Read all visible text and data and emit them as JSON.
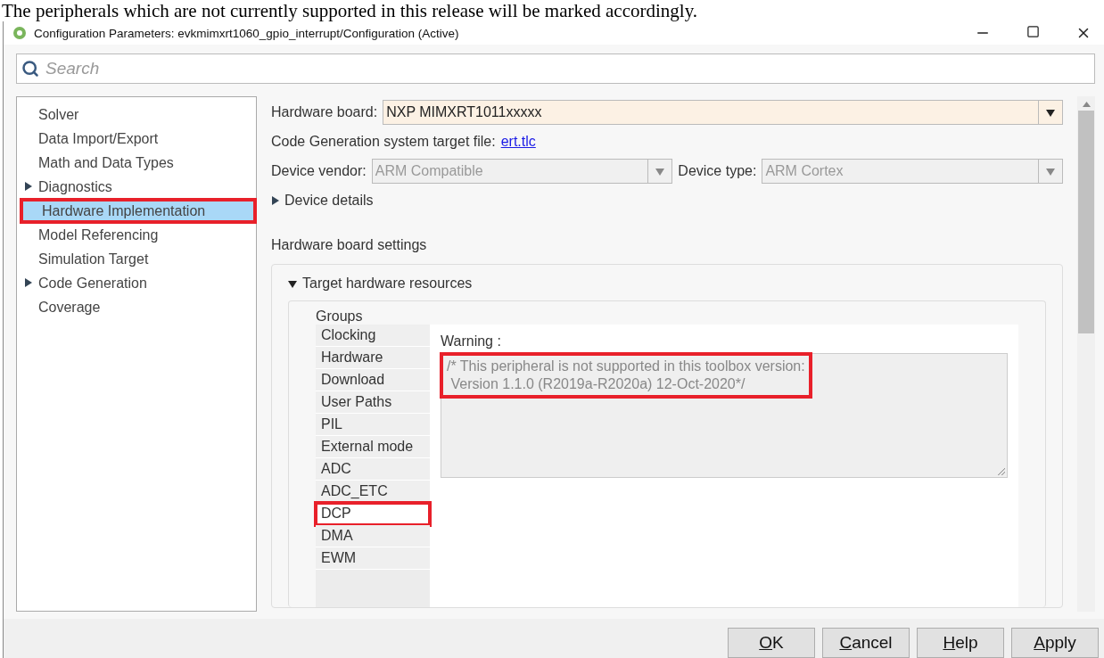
{
  "caption": "The peripherals which are not currently supported in this release will be marked accordingly.",
  "window": {
    "title": "Configuration Parameters: evkmimxrt1060_gpio_interrupt/Configuration (Active)"
  },
  "search": {
    "placeholder": "Search"
  },
  "sidebar": {
    "items": [
      {
        "label": "Solver",
        "expandable": false,
        "selected": false,
        "highlighted": false
      },
      {
        "label": "Data Import/Export",
        "expandable": false,
        "selected": false,
        "highlighted": false
      },
      {
        "label": "Math and Data Types",
        "expandable": false,
        "selected": false,
        "highlighted": false
      },
      {
        "label": "Diagnostics",
        "expandable": true,
        "selected": false,
        "highlighted": false
      },
      {
        "label": "Hardware Implementation",
        "expandable": false,
        "selected": true,
        "highlighted": true
      },
      {
        "label": "Model Referencing",
        "expandable": false,
        "selected": false,
        "highlighted": false
      },
      {
        "label": "Simulation Target",
        "expandable": false,
        "selected": false,
        "highlighted": false
      },
      {
        "label": "Code Generation",
        "expandable": true,
        "selected": false,
        "highlighted": false
      },
      {
        "label": "Coverage",
        "expandable": false,
        "selected": false,
        "highlighted": false
      }
    ]
  },
  "hardware_board": {
    "label": "Hardware board:",
    "value": "NXP MIMXRT1011xxxxx"
  },
  "target_file": {
    "label": "Code Generation system target file:",
    "link": "ert.tlc"
  },
  "device_vendor": {
    "label": "Device vendor:",
    "value": "ARM Compatible",
    "disabled": true
  },
  "device_type": {
    "label": "Device type:",
    "value": "ARM Cortex",
    "disabled": true
  },
  "device_details": {
    "label": "Device details",
    "expanded": false
  },
  "board_settings": {
    "title": "Hardware board settings",
    "section": {
      "label": "Target hardware resources",
      "expanded": true
    },
    "groups_title": "Groups",
    "groups": [
      {
        "label": "Clocking",
        "selected": false,
        "highlighted": false
      },
      {
        "label": "Hardware",
        "selected": false,
        "highlighted": false
      },
      {
        "label": "Download",
        "selected": false,
        "highlighted": false
      },
      {
        "label": "User Paths",
        "selected": false,
        "highlighted": false
      },
      {
        "label": "PIL",
        "selected": false,
        "highlighted": false
      },
      {
        "label": "External mode",
        "selected": false,
        "highlighted": false
      },
      {
        "label": "ADC",
        "selected": false,
        "highlighted": false
      },
      {
        "label": "ADC_ETC",
        "selected": false,
        "highlighted": false
      },
      {
        "label": "DCP",
        "selected": true,
        "highlighted": true
      },
      {
        "label": "DMA",
        "selected": false,
        "highlighted": false
      },
      {
        "label": "EWM",
        "selected": false,
        "highlighted": false
      }
    ],
    "warning": {
      "label": "Warning :",
      "text": "/* This peripheral is not supported in this toolbox version:\n Version 1.1.0 (R2019a-R2020a) 12-Oct-2020*/",
      "highlighted": true
    }
  },
  "buttons": [
    "OK",
    "Cancel",
    "Help",
    "Apply"
  ]
}
